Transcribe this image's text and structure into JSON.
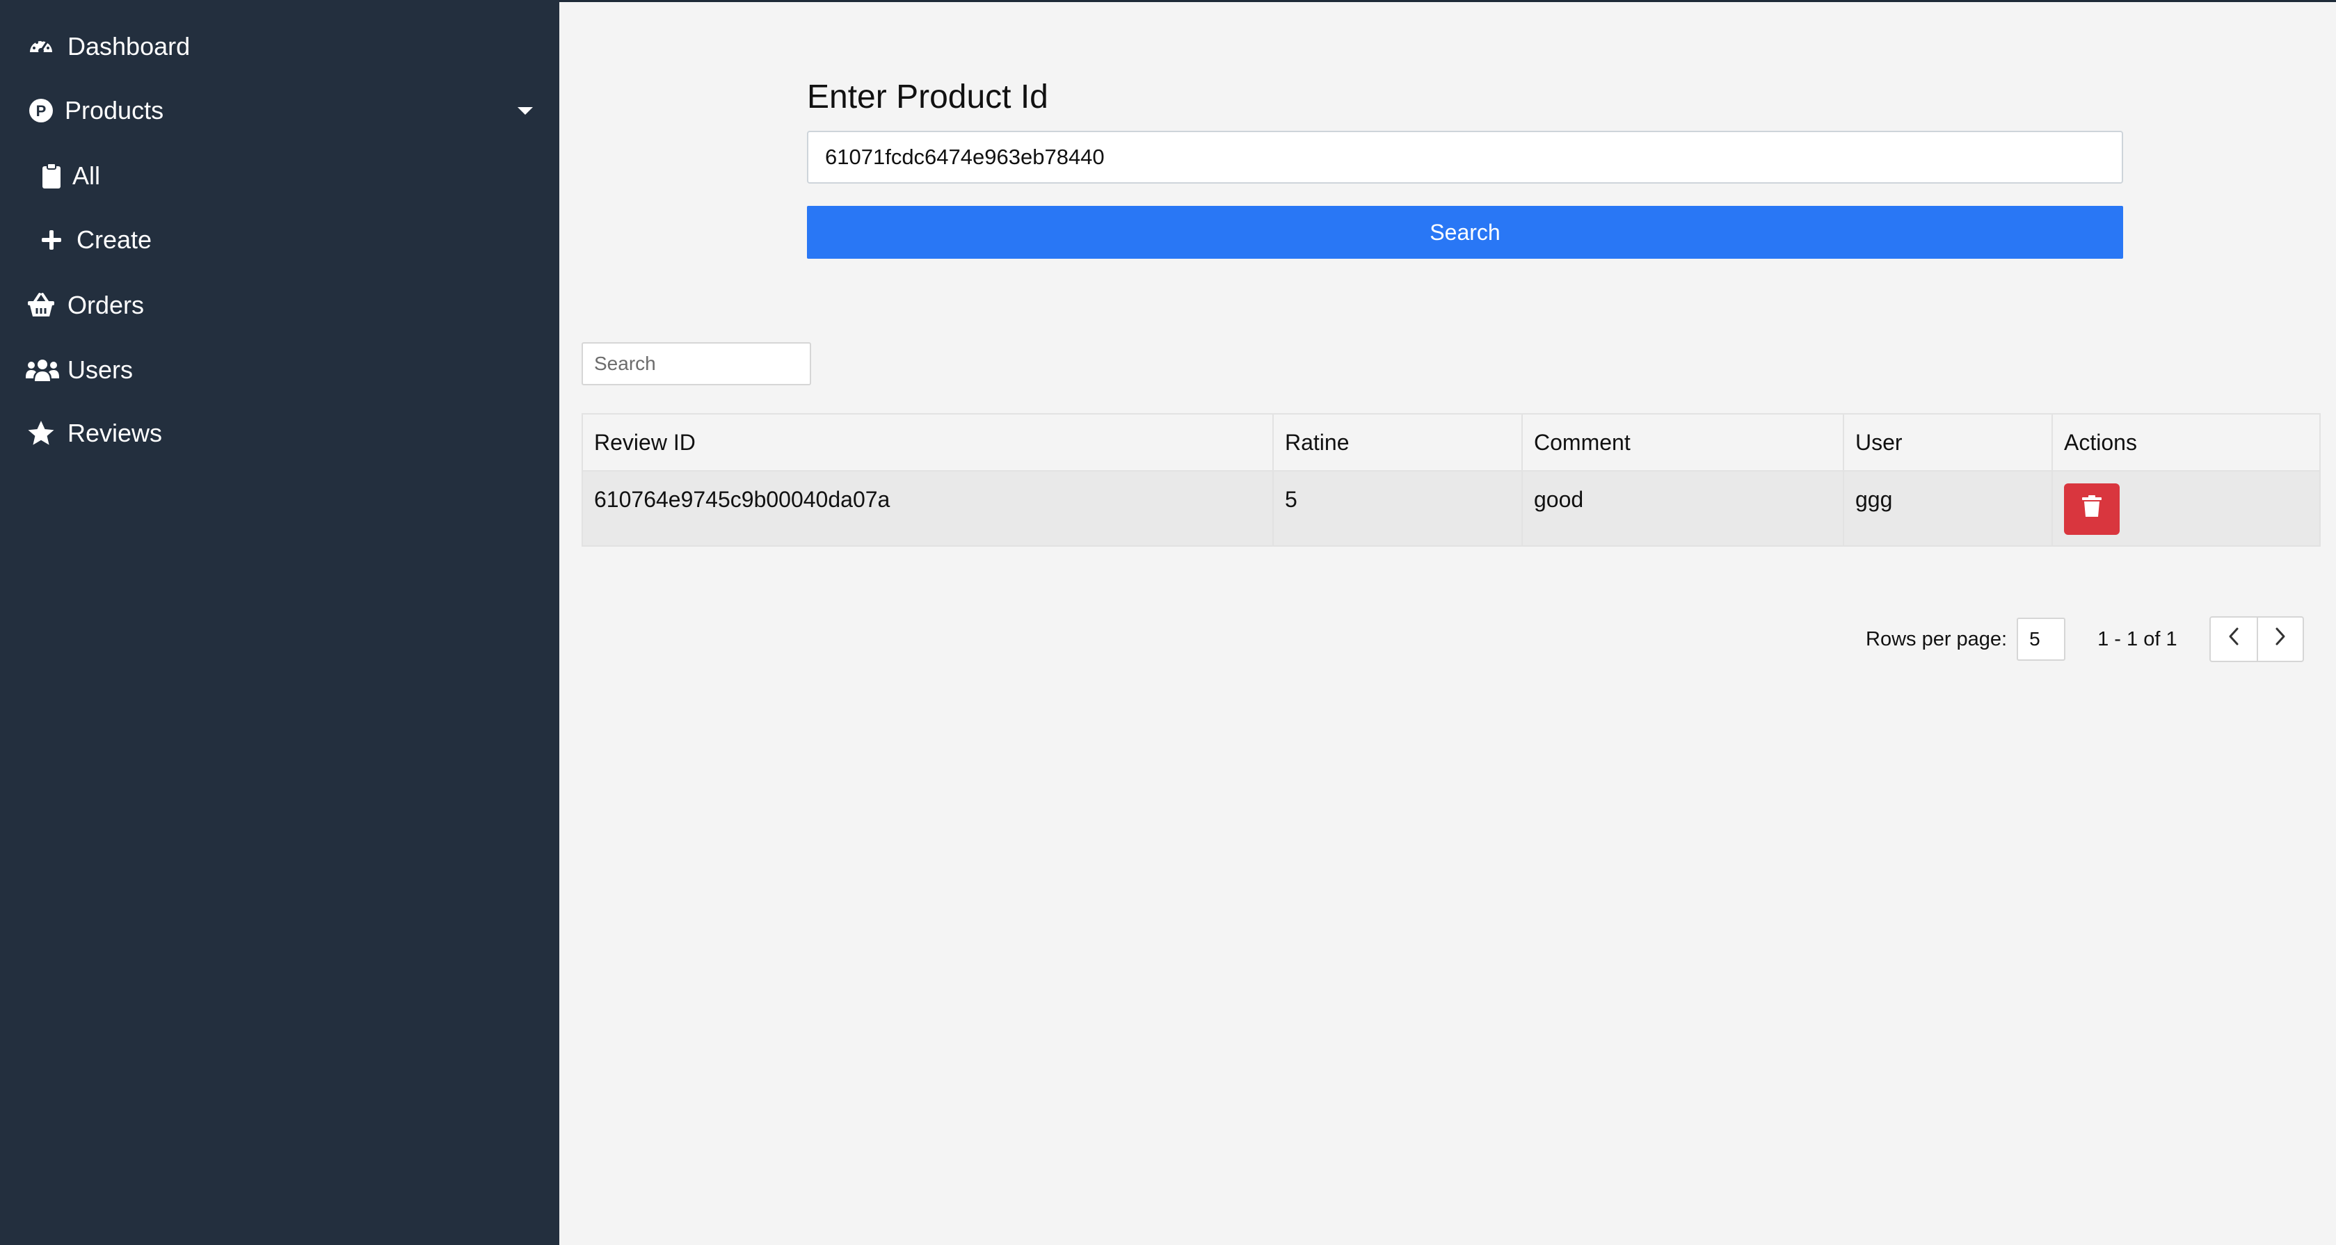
{
  "sidebar": {
    "items": [
      {
        "label": "Dashboard",
        "icon": "dashboard-icon"
      },
      {
        "label": "Products",
        "icon": "product-p-icon",
        "expanded": true
      },
      {
        "label": "All",
        "icon": "clipboard-icon"
      },
      {
        "label": "Create",
        "icon": "plus-icon"
      },
      {
        "label": "Orders",
        "icon": "basket-icon"
      },
      {
        "label": "Users",
        "icon": "users-icon"
      },
      {
        "label": "Reviews",
        "icon": "star-icon"
      }
    ]
  },
  "form": {
    "title": "Enter Product Id",
    "product_id_value": "61071fcdc6474e963eb78440",
    "search_label": "Search"
  },
  "table": {
    "search_placeholder": "Search",
    "columns": [
      "Review ID",
      "Ratine",
      "Comment",
      "User",
      "Actions"
    ],
    "rows": [
      {
        "review_id": "610764e9745c9b00040da07a",
        "rating": "5",
        "comment": "good",
        "user": "ggg",
        "action_icon": "trash-icon"
      }
    ]
  },
  "pagination": {
    "rows_per_page_label": "Rows per page:",
    "rows_per_page_value": "5",
    "range_text": "1 - 1 of 1"
  },
  "colors": {
    "sidebar_bg": "#232f3e",
    "primary": "#2977f5",
    "danger": "#d9363e",
    "page_bg": "#f4f4f4"
  }
}
